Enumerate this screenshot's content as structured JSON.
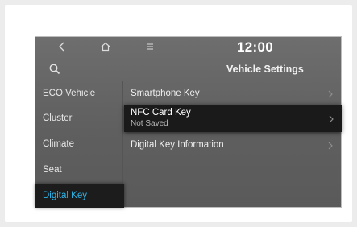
{
  "header": {
    "time": "12:00",
    "title": "Vehicle Settings",
    "icons": [
      "back-icon",
      "home-icon",
      "menu-icon",
      "search-icon"
    ]
  },
  "sidebar": {
    "items": [
      {
        "label": "ECO Vehicle"
      },
      {
        "label": "Cluster"
      },
      {
        "label": "Climate"
      },
      {
        "label": "Seat"
      },
      {
        "label": "Digital Key",
        "selected": true
      }
    ]
  },
  "main": {
    "items": [
      {
        "label": "Smartphone Key"
      },
      {
        "label": "NFC Card Key",
        "sublabel": "Not Saved",
        "highlighted": true
      },
      {
        "label": "Digital Key Information"
      }
    ]
  },
  "colors": {
    "screen_bg": "#666666",
    "selected_text": "#2fb4e8",
    "highlight_bg": "#1a1a1a"
  }
}
